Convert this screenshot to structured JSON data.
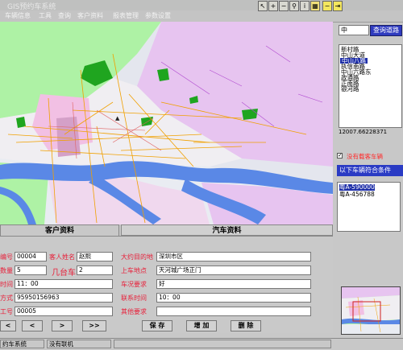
{
  "window": {
    "title": "GIS预约车系统"
  },
  "menu": [
    "车辆信息",
    "工具",
    "查询",
    "客户资料",
    "报表管理",
    "参数设置"
  ],
  "toolbar": [
    {
      "icon": "pointer-icon",
      "glyph": "↖"
    },
    {
      "icon": "zoom-in-icon",
      "glyph": "+"
    },
    {
      "icon": "zoom-out-icon",
      "glyph": "−"
    },
    {
      "icon": "search-icon",
      "glyph": "⚲"
    },
    {
      "icon": "info-icon",
      "glyph": "i"
    },
    {
      "icon": "layers-icon",
      "glyph": "▦"
    },
    {
      "icon": "minus-icon",
      "glyph": "−"
    },
    {
      "icon": "exit-icon",
      "glyph": "⇥"
    }
  ],
  "street_search": {
    "value": "中",
    "button": "查询道路"
  },
  "streets": [
    "新村路",
    "中山大道",
    "中山八路",
    "执信南路",
    "中山六路东",
    "政通路",
    "正南路",
    "银河路"
  ],
  "street_selected_index": 2,
  "coords": "12007.66228371",
  "nocar_label": "没有载客车辆",
  "lower_header": "以下车辆符合条件",
  "vehicles": [
    "粤A-590000",
    "粤A-456788"
  ],
  "vehicle_selected_index": 0,
  "tabs": {
    "customer": "客户资料",
    "vehicle": "汽车资料"
  },
  "form": {
    "id_label": "编号",
    "id_value": "00004",
    "name_label": "客人姓名",
    "name_value": "赵熙",
    "count_label": "数量",
    "count_value": "5",
    "cars_label": "几台车",
    "cars_value": "2",
    "time_label": "时间",
    "time_value": "11：00",
    "contact_label": "方式",
    "contact_value": "95950156963",
    "worker_label": "工号",
    "worker_value": "00005",
    "dest_label": "大约目的地",
    "dest_value": "深圳市区",
    "pickup_label": "上车地点",
    "pickup_value": "天河城广场正门",
    "req_label": "车况要求",
    "req_value": "好",
    "ctime_label": "联系时间",
    "ctime_value": "10：00",
    "other_label": "其他要求",
    "other_value": ""
  },
  "nav": {
    "first": "<",
    "prev": "<",
    "next": ">",
    "last": ">>"
  },
  "actions": {
    "save": "保 存",
    "add": "增 加",
    "delete": "删 除"
  },
  "status": {
    "left": "约车系统",
    "right": "没有联机"
  }
}
